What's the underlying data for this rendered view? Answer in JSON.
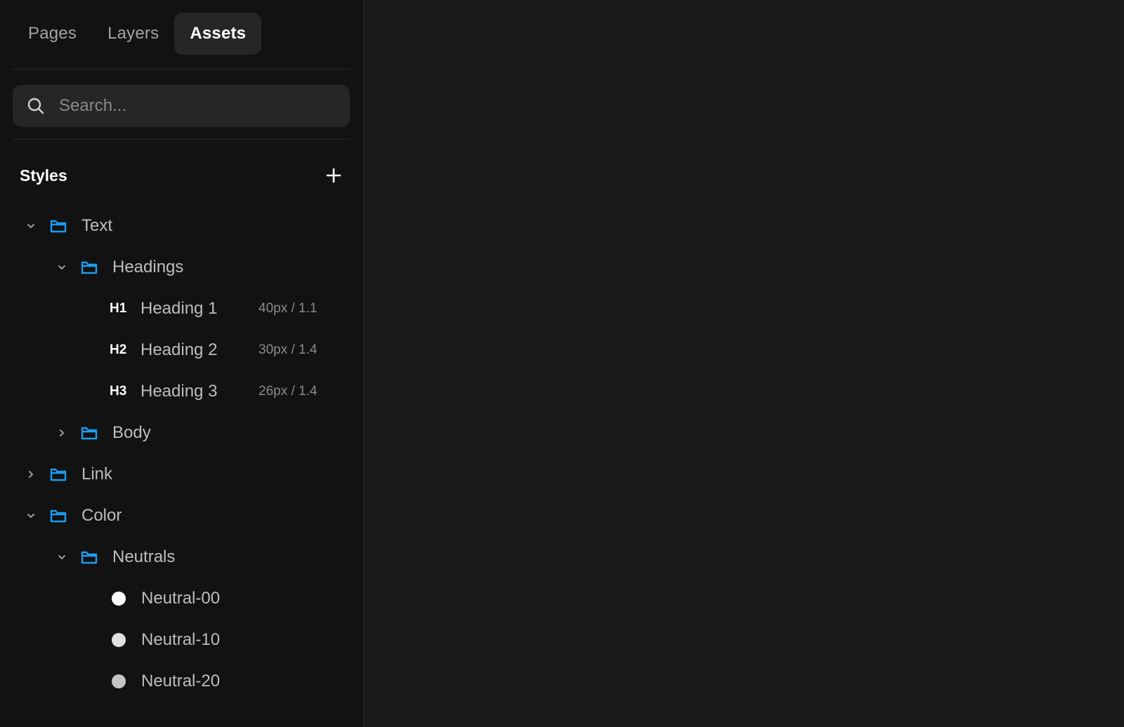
{
  "tabs": [
    {
      "label": "Pages",
      "active": false
    },
    {
      "label": "Layers",
      "active": false
    },
    {
      "label": "Assets",
      "active": true
    }
  ],
  "search": {
    "placeholder": "Search...",
    "value": ""
  },
  "styles": {
    "title": "Styles",
    "add_icon": "plus-icon"
  },
  "tree": {
    "text_folder": {
      "label": "Text",
      "expanded": true
    },
    "headings_folder": {
      "label": "Headings",
      "expanded": true
    },
    "headings": [
      {
        "badge": "H1",
        "label": "Heading 1",
        "meta": "40px / 1.1"
      },
      {
        "badge": "H2",
        "label": "Heading 2",
        "meta": "30px / 1.4"
      },
      {
        "badge": "H3",
        "label": "Heading 3",
        "meta": "26px / 1.4"
      }
    ],
    "body_folder": {
      "label": "Body",
      "expanded": false
    },
    "link_folder": {
      "label": "Link",
      "expanded": false
    },
    "color_folder": {
      "label": "Color",
      "expanded": true
    },
    "neutrals_folder": {
      "label": "Neutrals",
      "expanded": true
    },
    "neutrals": [
      {
        "label": "Neutral-00",
        "color": "#ffffff"
      },
      {
        "label": "Neutral-10",
        "color": "#e0e0e0"
      },
      {
        "label": "Neutral-20",
        "color": "#c4c4c4"
      }
    ]
  },
  "colors": {
    "accent_folder": "#1d9bf0",
    "sidebar_bg": "#121212",
    "canvas_bg": "#1a1a1a"
  }
}
